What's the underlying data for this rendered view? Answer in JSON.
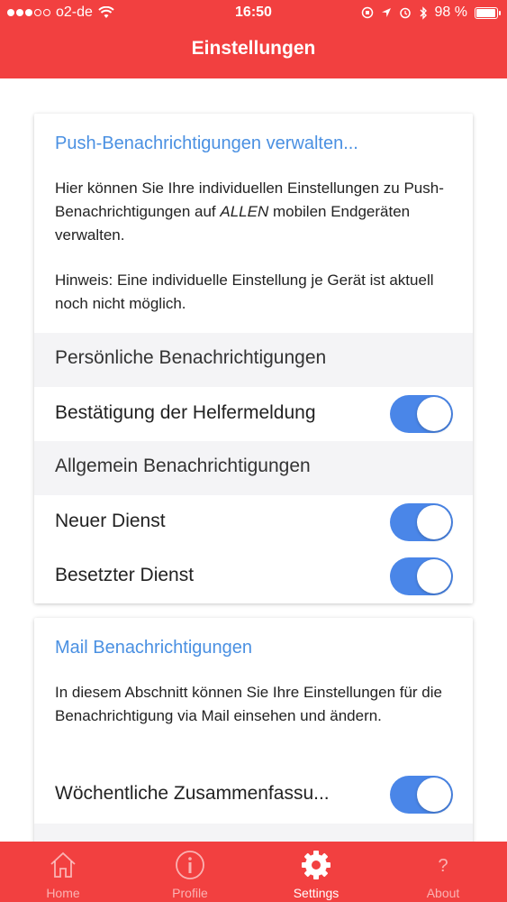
{
  "status_bar": {
    "carrier": "o2-de",
    "time": "16:50",
    "battery": "98 %",
    "battery_level": 0.98
  },
  "header": {
    "title": "Einstellungen"
  },
  "push_card": {
    "title": "Push-Benachrichtigungen verwalten...",
    "description_part1": "Hier können Sie Ihre individuellen Einstellungen zu Push-Benachrichtigungen auf ",
    "description_emphasis": "ALLEN",
    "description_part2": " mobilen Endgeräten verwalten.",
    "hint": "Hinweis: Eine individuelle Einstellung je Gerät ist aktuell noch nicht möglich.",
    "section_personal": "Persönliche Benachrichtigungen",
    "personal_items": [
      {
        "label": "Bestätigung der Helfermeldung",
        "enabled": true
      }
    ],
    "section_general": "Allgemein Benachrichtigungen",
    "general_items": [
      {
        "label": "Neuer Dienst",
        "enabled": true
      },
      {
        "label": "Besetzter Dienst",
        "enabled": true
      }
    ]
  },
  "mail_card": {
    "title": "Mail Benachrichtigungen",
    "description": "In diesem Abschnitt können Sie Ihre Einstellungen für die Benachrichtigung via Mail einsehen und ändern.",
    "items": [
      {
        "label": "Wöchentliche Zusammenfassu...",
        "enabled": true
      }
    ]
  },
  "tabbar": {
    "tabs": [
      {
        "label": "Home",
        "icon": "home-icon",
        "active": false
      },
      {
        "label": "Profile",
        "icon": "info-icon",
        "active": false
      },
      {
        "label": "Settings",
        "icon": "gear-icon",
        "active": true
      },
      {
        "label": "About",
        "icon": "question-icon",
        "active": false
      }
    ]
  },
  "colors": {
    "brand_red": "#f24040",
    "link_blue": "#4a90e2",
    "toggle_on": "#4a86e8"
  }
}
